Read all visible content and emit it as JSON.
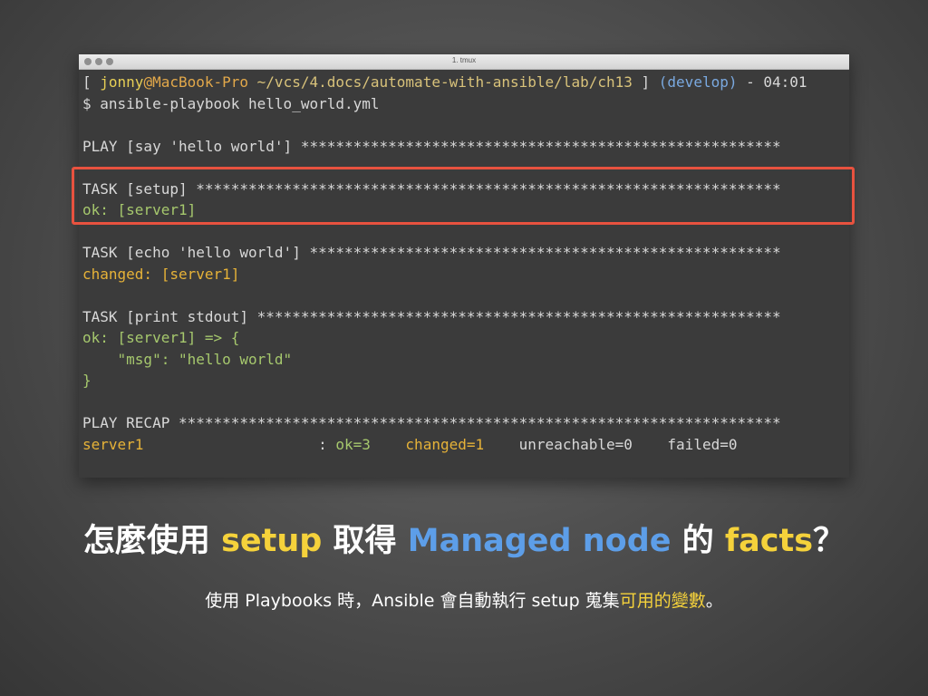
{
  "window": {
    "title": "1. tmux"
  },
  "terminal": {
    "lines": [
      [
        {
          "text": "[ ",
          "color": "#d8d8d8"
        },
        {
          "text": "jonny",
          "color": "#e7cf55"
        },
        {
          "text": "@MacBook-Pro",
          "color": "#e2a84a"
        },
        {
          "text": " ~/vcs/4.docs/automate-with-ansible/lab/ch13",
          "color": "#d8c27a"
        },
        {
          "text": " ] ",
          "color": "#d8d8d8"
        },
        {
          "text": "(develop)",
          "color": "#7aa9e0"
        },
        {
          "text": " - 04:01",
          "color": "#d8d8d8"
        }
      ],
      [
        {
          "text": "$ ansible-playbook hello_world.yml",
          "color": "#d8d8d8"
        }
      ],
      [],
      [
        {
          "text": "PLAY [say 'hello world'] *******************************************************",
          "color": "#d8d8d8"
        }
      ],
      [],
      [
        {
          "text": "TASK [setup] *******************************************************************",
          "color": "#d8d8d8"
        }
      ],
      [
        {
          "text": "ok: [server1]",
          "color": "#a6c86d"
        }
      ],
      [],
      [
        {
          "text": "TASK [echo 'hello world'] ******************************************************",
          "color": "#d8d8d8"
        }
      ],
      [
        {
          "text": "changed: [server1]",
          "color": "#e6b238"
        }
      ],
      [],
      [
        {
          "text": "TASK [print stdout] ************************************************************",
          "color": "#d8d8d8"
        }
      ],
      [
        {
          "text": "ok: [server1] => {",
          "color": "#a6c86d"
        }
      ],
      [
        {
          "text": "    \"msg\": \"hello world\"",
          "color": "#a6c86d"
        }
      ],
      [
        {
          "text": "}",
          "color": "#a6c86d"
        }
      ],
      [],
      [
        {
          "text": "PLAY RECAP *********************************************************************",
          "color": "#d8d8d8"
        }
      ],
      [
        {
          "text": "server1",
          "color": "#e6b238"
        },
        {
          "text": "                    : ",
          "color": "#d8d8d8"
        },
        {
          "text": "ok=3",
          "color": "#a6c86d"
        },
        {
          "text": "    ",
          "color": "#d8d8d8"
        },
        {
          "text": "changed=1",
          "color": "#e6b238"
        },
        {
          "text": "    unreachable=0    failed=0",
          "color": "#d8d8d8"
        }
      ]
    ]
  },
  "headline": {
    "part1": "怎麼使用 ",
    "setup": "setup",
    "part2": " 取得 ",
    "managed": "Managed node",
    "part3": " 的 ",
    "facts": "facts",
    "part4": "？"
  },
  "subline": {
    "part1": "使用 Playbooks 時，Ansible 會自動執行 setup 蒐集",
    "vars": "可用的變數",
    "part2": "。"
  },
  "colors": {
    "highlight_border": "#e8523f",
    "accent_yellow": "#f5d23b",
    "accent_blue": "#5d9ee8"
  }
}
